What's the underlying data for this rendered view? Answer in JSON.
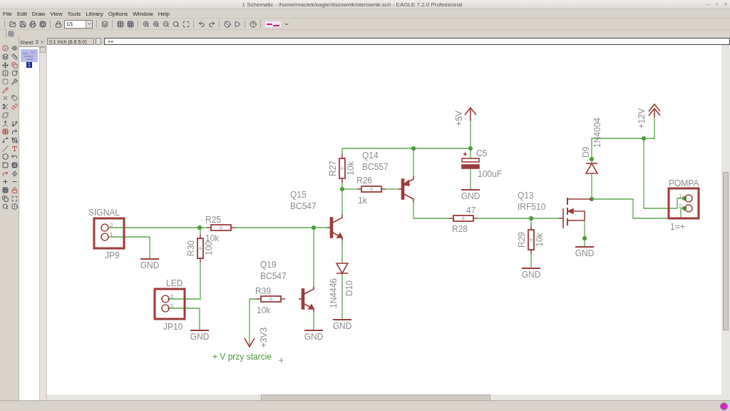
{
  "window": {
    "title": "1 Schematic - /home/maciek/eagle/dozownik/sterownik.sch - EAGLE 7.2.0 Professional",
    "controls": [
      "–",
      "+",
      "×"
    ]
  },
  "menu": [
    "File",
    "Edit",
    "Draw",
    "View",
    "Tools",
    "Library",
    "Options",
    "Window",
    "Help"
  ],
  "toolbar": {
    "sheet_select": "1/1"
  },
  "sheets_panel": {
    "title": "Sheet:",
    "sheets": [
      {
        "label": "1",
        "selected": true
      }
    ]
  },
  "command_bar": {
    "grid": "0.1 inch (6.6 5.0)",
    "command": "++"
  },
  "schematic": {
    "parts": [
      {
        "kind": "connector",
        "name": "JP9",
        "label": "SIGNAL",
        "pins": [
          "2",
          "1"
        ]
      },
      {
        "kind": "resistor",
        "name": "R25",
        "value": "10k"
      },
      {
        "kind": "resistor",
        "name": "R30",
        "value": "100"
      },
      {
        "kind": "connector",
        "name": "JP10",
        "label": "LED",
        "pins": [
          "2",
          "1"
        ]
      },
      {
        "kind": "resistor",
        "name": "R27",
        "value": "10k"
      },
      {
        "kind": "resistor",
        "name": "R26",
        "value": "1k"
      },
      {
        "kind": "npn",
        "name": "Q15",
        "value": "BC547"
      },
      {
        "kind": "npn",
        "name": "Q19",
        "value": "BC547"
      },
      {
        "kind": "resistor",
        "name": "R39",
        "value": "10k"
      },
      {
        "kind": "diode",
        "name": "D10",
        "value": "1N4446"
      },
      {
        "kind": "pnp",
        "name": "Q14",
        "value": "BC557"
      },
      {
        "kind": "capacitor",
        "name": "C5",
        "value": "100uF"
      },
      {
        "kind": "resistor",
        "name": "R28",
        "value": "47"
      },
      {
        "kind": "resistor",
        "name": "R29",
        "value": "10k"
      },
      {
        "kind": "nmos",
        "name": "Q13",
        "value": "IRF510"
      },
      {
        "kind": "diode",
        "name": "D9",
        "value": "1N4004"
      },
      {
        "kind": "connector",
        "label": "POMPA",
        "note": "1=+",
        "pins": [
          "1",
          "2"
        ]
      }
    ],
    "supplies": [
      {
        "kind": "single",
        "label": "+5V"
      },
      {
        "kind": "double",
        "label": "+12V"
      },
      {
        "kind": "down",
        "label": "+3V3"
      }
    ],
    "grounds": [
      {
        "label": "GND"
      },
      {
        "label": "GND"
      },
      {
        "label": "GND"
      },
      {
        "label": "GND"
      },
      {
        "label": "GND"
      },
      {
        "label": "GND"
      },
      {
        "label": "GND"
      }
    ],
    "notes": [
      {
        "text": "+ V przy starcie"
      }
    ]
  }
}
